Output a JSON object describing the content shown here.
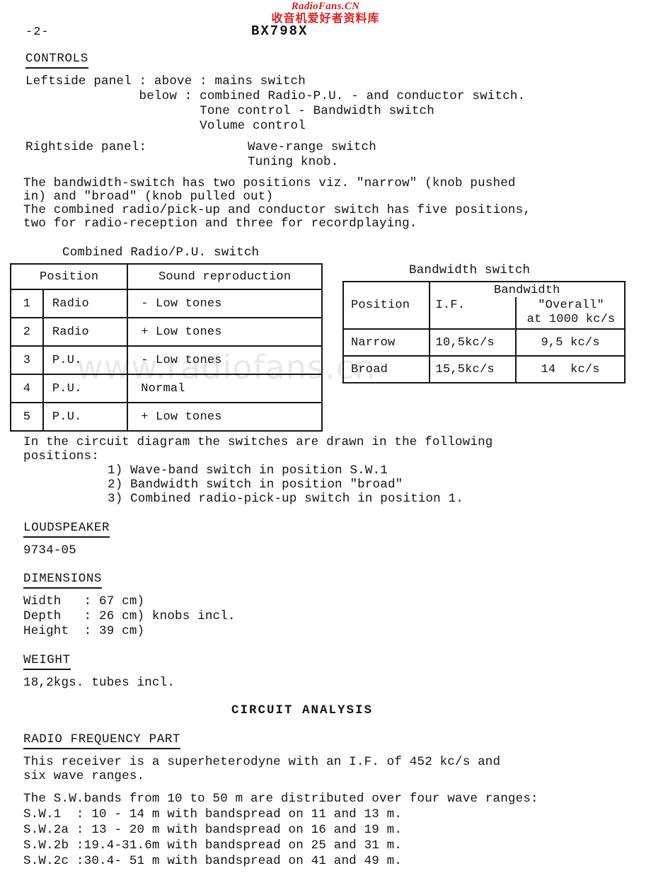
{
  "watermark": {
    "brand": "RadioFans.CN",
    "brand_cn": "收音机爱好者资料库",
    "diagonal": "www.radiofans.cn",
    "brand_color": "#d61a1a",
    "diagonal_color": "#e9e9e9"
  },
  "page": {
    "page_number": "-2-",
    "model": "BX798X"
  },
  "controls": {
    "heading": "CONTROLS",
    "lines": [
      "Leftside panel : above : mains switch",
      "               below : combined Radio-P.U. - and conductor switch.",
      "                       Tone control - Bandwidth switch",
      "                       Volume control"
    ],
    "rightside_label": "Rightside panel:",
    "rightside_items": [
      "Wave-range switch",
      "Tuning knob."
    ],
    "paragraph": [
      "The bandwidth-switch has two positions viz. \"narrow\" (knob pushed",
      "in) and \"broad\" (knob pulled out)",
      "The combined radio/pick-up and conductor switch has five positions,",
      "two for radio-reception and three for recordplaying."
    ]
  },
  "combined_table": {
    "caption": "Combined Radio/P.U. switch",
    "headers": [
      "Position",
      "Sound reproduction"
    ],
    "rows": [
      {
        "num": "1",
        "source": "Radio",
        "sound": "- Low tones"
      },
      {
        "num": "2",
        "source": "Radio",
        "sound": "+ Low tones"
      },
      {
        "num": "3",
        "source": "P.U.",
        "sound": "- Low tones"
      },
      {
        "num": "4",
        "source": "P.U.",
        "sound": "Normal"
      },
      {
        "num": "5",
        "source": "P.U.",
        "sound": "+ Low tones"
      }
    ]
  },
  "bandwidth_table": {
    "caption": "Bandwidth switch",
    "header_position": "Position",
    "header_bandwidth": "Bandwidth",
    "header_if": "I.F.",
    "header_overall_line1": "\"Overall\"",
    "header_overall_line2": "at 1000 kc/s",
    "rows": [
      {
        "position": "Narrow",
        "if": "10,5kc/s",
        "overall": "9,5 kc/s"
      },
      {
        "position": "Broad",
        "if": "15,5kc/s",
        "overall": "14  kc/s"
      }
    ]
  },
  "circuit_positions": {
    "intro": [
      "In the circuit diagram the switches are drawn in the following",
      "positions:"
    ],
    "items": [
      "1) Wave-band switch in position S.W.1",
      "2) Bandwidth switch in position \"broad\"",
      "3) Combined radio-pick-up switch in position 1."
    ]
  },
  "loudspeaker": {
    "heading": "LOUDSPEAKER",
    "value": "9734-05"
  },
  "dimensions": {
    "heading": "DIMENSIONS",
    "lines": [
      "Width   : 67 cm)",
      "Depth   : 26 cm) knobs incl.",
      "Height  : 39 cm)"
    ]
  },
  "weight": {
    "heading": "WEIGHT",
    "value": "18,2kgs. tubes incl."
  },
  "circuit_analysis": {
    "title": "CIRCUIT ANALYSIS",
    "section_heading": "RADIO FREQUENCY PART",
    "paragraph": [
      "This receiver is a superheterodyne with an I.F. of 452 kc/s and",
      "six wave ranges."
    ],
    "sw_intro": "The S.W.bands from 10 to 50 m are distributed over four wave ranges:",
    "sw_rows": [
      "S.W.1  : 10 - 14 m with bandspread on 11 and 13 m.",
      "S.W.2a : 13 - 20 m with bandspread on 16 and 19 m.",
      "S.W.2b :19.4-31.6m with bandspread on 25 and 31 m.",
      "S.W.2c :30.4- 51 m with bandspread on 41 and 49 m."
    ]
  }
}
